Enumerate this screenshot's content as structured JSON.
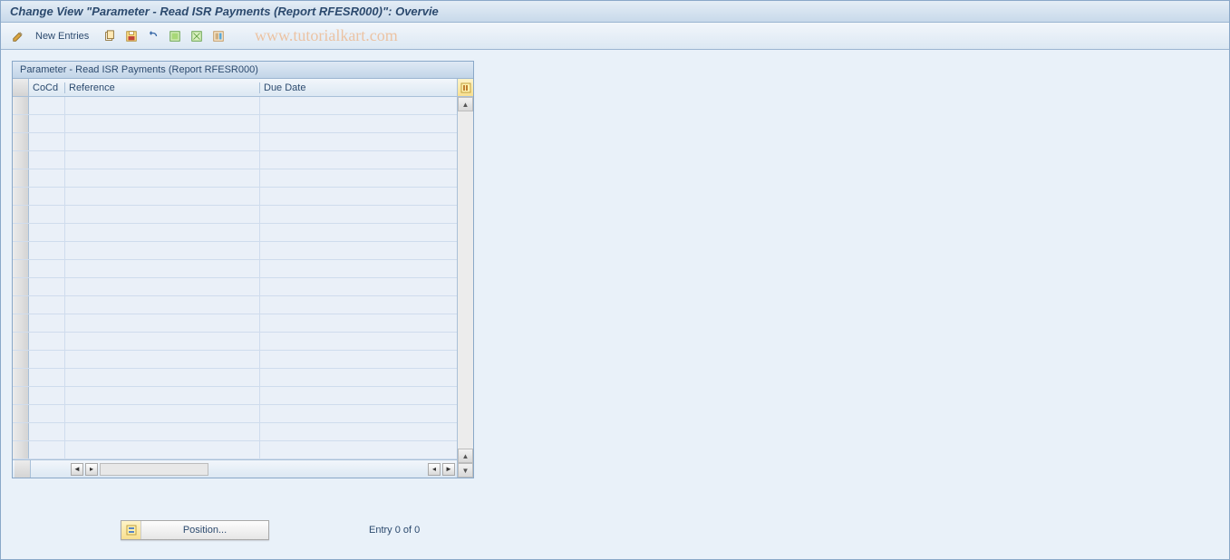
{
  "title": "Change View \"Parameter - Read ISR Payments (Report RFESR000)\": Overvie",
  "toolbar": {
    "new_entries": "New Entries"
  },
  "watermark": "www.tutorialkart.com",
  "panel": {
    "header": "Parameter - Read ISR Payments (Report RFESR000)",
    "columns": {
      "cocd": "CoCd",
      "reference": "Reference",
      "due_date": "Due Date"
    },
    "rows": [
      {
        "cocd": "",
        "reference": "",
        "due_date": ""
      },
      {
        "cocd": "",
        "reference": "",
        "due_date": ""
      },
      {
        "cocd": "",
        "reference": "",
        "due_date": ""
      },
      {
        "cocd": "",
        "reference": "",
        "due_date": ""
      },
      {
        "cocd": "",
        "reference": "",
        "due_date": ""
      },
      {
        "cocd": "",
        "reference": "",
        "due_date": ""
      },
      {
        "cocd": "",
        "reference": "",
        "due_date": ""
      },
      {
        "cocd": "",
        "reference": "",
        "due_date": ""
      },
      {
        "cocd": "",
        "reference": "",
        "due_date": ""
      },
      {
        "cocd": "",
        "reference": "",
        "due_date": ""
      },
      {
        "cocd": "",
        "reference": "",
        "due_date": ""
      },
      {
        "cocd": "",
        "reference": "",
        "due_date": ""
      },
      {
        "cocd": "",
        "reference": "",
        "due_date": ""
      },
      {
        "cocd": "",
        "reference": "",
        "due_date": ""
      },
      {
        "cocd": "",
        "reference": "",
        "due_date": ""
      },
      {
        "cocd": "",
        "reference": "",
        "due_date": ""
      },
      {
        "cocd": "",
        "reference": "",
        "due_date": ""
      },
      {
        "cocd": "",
        "reference": "",
        "due_date": ""
      },
      {
        "cocd": "",
        "reference": "",
        "due_date": ""
      },
      {
        "cocd": "",
        "reference": "",
        "due_date": ""
      }
    ]
  },
  "footer": {
    "position_label": "Position...",
    "entry_text": "Entry 0 of 0"
  },
  "icons": {
    "pencil": "pencil-icon",
    "copy": "copy-icon",
    "save": "save-icon",
    "undo": "undo-icon",
    "select_all": "select-all-icon",
    "table_settings": "table-settings-icon",
    "delete": "delete-icon",
    "configure": "configure-columns-icon"
  }
}
